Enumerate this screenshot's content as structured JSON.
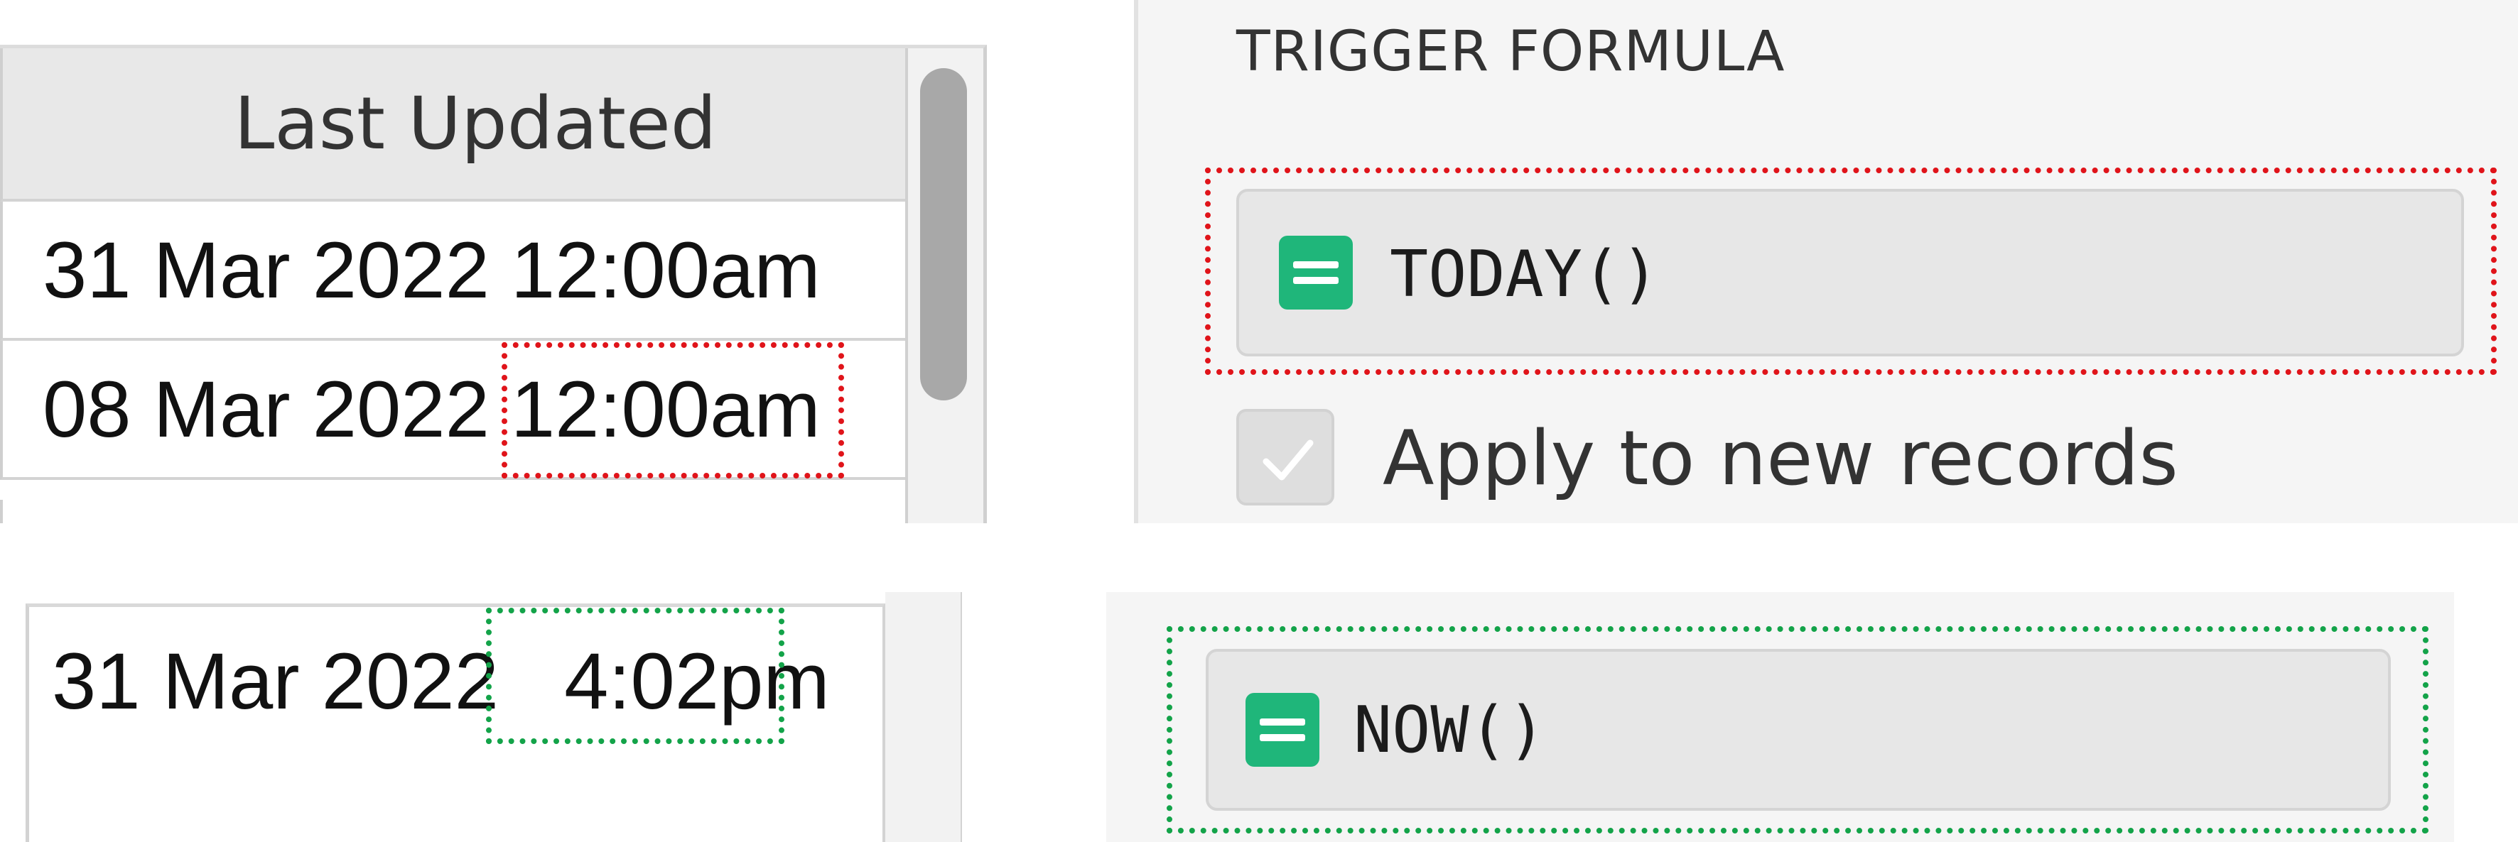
{
  "top_grid": {
    "header": "Last Updated",
    "rows": [
      {
        "date": "31 Mar 2022",
        "time": "12:00am"
      },
      {
        "date": "08 Mar 2022",
        "time": "12:00am"
      }
    ]
  },
  "trigger_panel": {
    "section_label": "TRIGGER FORMULA",
    "formula": "TODAY()",
    "checkbox_label": "Apply to new records",
    "checkbox_checked": true,
    "icon": "formula-icon"
  },
  "bottom_grid": {
    "date": "31 Mar 2022",
    "time": "4:02pm"
  },
  "bottom_panel": {
    "formula": "NOW()",
    "icon": "formula-icon"
  },
  "colors": {
    "formula_icon": "#1fb67a",
    "highlight_red": "#e0141a",
    "highlight_green": "#13a349"
  }
}
